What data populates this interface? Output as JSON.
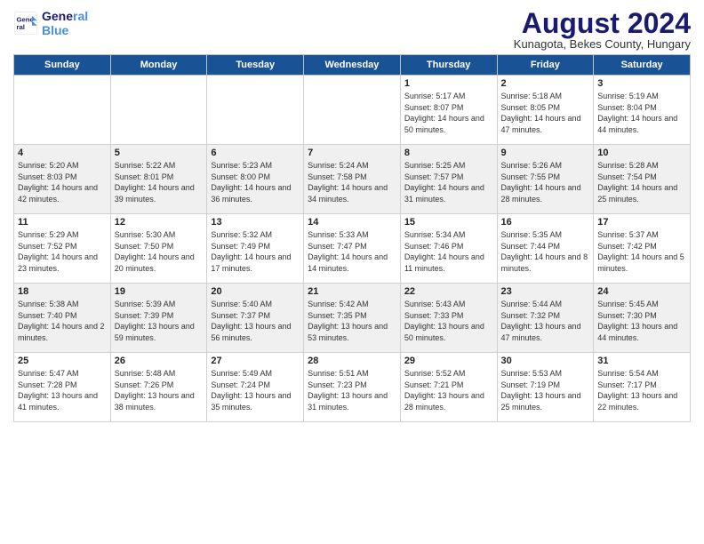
{
  "header": {
    "logo_line1": "General",
    "logo_line2": "Blue",
    "month_title": "August 2024",
    "subtitle": "Kunagota, Bekes County, Hungary"
  },
  "days_of_week": [
    "Sunday",
    "Monday",
    "Tuesday",
    "Wednesday",
    "Thursday",
    "Friday",
    "Saturday"
  ],
  "weeks": [
    [
      {
        "day": "",
        "info": ""
      },
      {
        "day": "",
        "info": ""
      },
      {
        "day": "",
        "info": ""
      },
      {
        "day": "",
        "info": ""
      },
      {
        "day": "1",
        "info": "Sunrise: 5:17 AM\nSunset: 8:07 PM\nDaylight: 14 hours\nand 50 minutes."
      },
      {
        "day": "2",
        "info": "Sunrise: 5:18 AM\nSunset: 8:05 PM\nDaylight: 14 hours\nand 47 minutes."
      },
      {
        "day": "3",
        "info": "Sunrise: 5:19 AM\nSunset: 8:04 PM\nDaylight: 14 hours\nand 44 minutes."
      }
    ],
    [
      {
        "day": "4",
        "info": "Sunrise: 5:20 AM\nSunset: 8:03 PM\nDaylight: 14 hours\nand 42 minutes."
      },
      {
        "day": "5",
        "info": "Sunrise: 5:22 AM\nSunset: 8:01 PM\nDaylight: 14 hours\nand 39 minutes."
      },
      {
        "day": "6",
        "info": "Sunrise: 5:23 AM\nSunset: 8:00 PM\nDaylight: 14 hours\nand 36 minutes."
      },
      {
        "day": "7",
        "info": "Sunrise: 5:24 AM\nSunset: 7:58 PM\nDaylight: 14 hours\nand 34 minutes."
      },
      {
        "day": "8",
        "info": "Sunrise: 5:25 AM\nSunset: 7:57 PM\nDaylight: 14 hours\nand 31 minutes."
      },
      {
        "day": "9",
        "info": "Sunrise: 5:26 AM\nSunset: 7:55 PM\nDaylight: 14 hours\nand 28 minutes."
      },
      {
        "day": "10",
        "info": "Sunrise: 5:28 AM\nSunset: 7:54 PM\nDaylight: 14 hours\nand 25 minutes."
      }
    ],
    [
      {
        "day": "11",
        "info": "Sunrise: 5:29 AM\nSunset: 7:52 PM\nDaylight: 14 hours\nand 23 minutes."
      },
      {
        "day": "12",
        "info": "Sunrise: 5:30 AM\nSunset: 7:50 PM\nDaylight: 14 hours\nand 20 minutes."
      },
      {
        "day": "13",
        "info": "Sunrise: 5:32 AM\nSunset: 7:49 PM\nDaylight: 14 hours\nand 17 minutes."
      },
      {
        "day": "14",
        "info": "Sunrise: 5:33 AM\nSunset: 7:47 PM\nDaylight: 14 hours\nand 14 minutes."
      },
      {
        "day": "15",
        "info": "Sunrise: 5:34 AM\nSunset: 7:46 PM\nDaylight: 14 hours\nand 11 minutes."
      },
      {
        "day": "16",
        "info": "Sunrise: 5:35 AM\nSunset: 7:44 PM\nDaylight: 14 hours\nand 8 minutes."
      },
      {
        "day": "17",
        "info": "Sunrise: 5:37 AM\nSunset: 7:42 PM\nDaylight: 14 hours\nand 5 minutes."
      }
    ],
    [
      {
        "day": "18",
        "info": "Sunrise: 5:38 AM\nSunset: 7:40 PM\nDaylight: 14 hours\nand 2 minutes."
      },
      {
        "day": "19",
        "info": "Sunrise: 5:39 AM\nSunset: 7:39 PM\nDaylight: 13 hours\nand 59 minutes."
      },
      {
        "day": "20",
        "info": "Sunrise: 5:40 AM\nSunset: 7:37 PM\nDaylight: 13 hours\nand 56 minutes."
      },
      {
        "day": "21",
        "info": "Sunrise: 5:42 AM\nSunset: 7:35 PM\nDaylight: 13 hours\nand 53 minutes."
      },
      {
        "day": "22",
        "info": "Sunrise: 5:43 AM\nSunset: 7:33 PM\nDaylight: 13 hours\nand 50 minutes."
      },
      {
        "day": "23",
        "info": "Sunrise: 5:44 AM\nSunset: 7:32 PM\nDaylight: 13 hours\nand 47 minutes."
      },
      {
        "day": "24",
        "info": "Sunrise: 5:45 AM\nSunset: 7:30 PM\nDaylight: 13 hours\nand 44 minutes."
      }
    ],
    [
      {
        "day": "25",
        "info": "Sunrise: 5:47 AM\nSunset: 7:28 PM\nDaylight: 13 hours\nand 41 minutes."
      },
      {
        "day": "26",
        "info": "Sunrise: 5:48 AM\nSunset: 7:26 PM\nDaylight: 13 hours\nand 38 minutes."
      },
      {
        "day": "27",
        "info": "Sunrise: 5:49 AM\nSunset: 7:24 PM\nDaylight: 13 hours\nand 35 minutes."
      },
      {
        "day": "28",
        "info": "Sunrise: 5:51 AM\nSunset: 7:23 PM\nDaylight: 13 hours\nand 31 minutes."
      },
      {
        "day": "29",
        "info": "Sunrise: 5:52 AM\nSunset: 7:21 PM\nDaylight: 13 hours\nand 28 minutes."
      },
      {
        "day": "30",
        "info": "Sunrise: 5:53 AM\nSunset: 7:19 PM\nDaylight: 13 hours\nand 25 minutes."
      },
      {
        "day": "31",
        "info": "Sunrise: 5:54 AM\nSunset: 7:17 PM\nDaylight: 13 hours\nand 22 minutes."
      }
    ]
  ]
}
